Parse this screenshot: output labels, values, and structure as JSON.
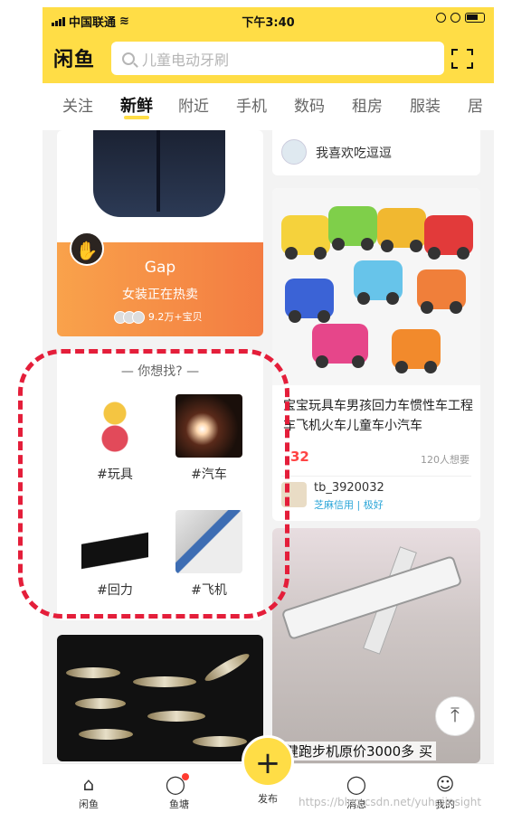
{
  "status_bar": {
    "carrier": "中国联通",
    "time": "下午3:40"
  },
  "header": {
    "logo": "闲鱼",
    "search_placeholder": "儿童电动牙刷"
  },
  "tabs": [
    {
      "label": "关注",
      "active": false
    },
    {
      "label": "新鲜",
      "active": true
    },
    {
      "label": "附近",
      "active": false
    },
    {
      "label": "手机",
      "active": false
    },
    {
      "label": "数码",
      "active": false
    },
    {
      "label": "租房",
      "active": false
    },
    {
      "label": "服装",
      "active": false
    },
    {
      "label": "居",
      "active": false
    }
  ],
  "left": {
    "gap": {
      "title": "Gap",
      "subtitle": "女装正在热卖",
      "count": "9.2万+宝贝"
    },
    "wish": {
      "title": "— 你想找? —",
      "items": [
        {
          "label": "#玩具"
        },
        {
          "label": "#汽车"
        },
        {
          "label": "#回力"
        },
        {
          "label": "#飞机"
        }
      ]
    }
  },
  "right": {
    "user_strip": {
      "name": "我喜欢吃逗逗"
    },
    "cars": {
      "title": "宝宝玩具车男孩回力车惯性车工程车飞机火车儿童车小汽车",
      "price": "32",
      "want": "120人想要",
      "seller": "tb_3920032",
      "credit": "芝麻信用 | 极好"
    },
    "treadmill": {
      "title": "健跑步机原价3000多 买"
    }
  },
  "nav": {
    "items": [
      {
        "label": "闲鱼"
      },
      {
        "label": "鱼塘"
      },
      {
        "label": "发布"
      },
      {
        "label": "消息"
      },
      {
        "label": "我的"
      }
    ]
  },
  "watermark": "https://blog.csdn.net/yuhqiinsight",
  "colors": {
    "brand_yellow": "#ffdd46",
    "price_red": "#ff4444",
    "highlight_red": "#e41e3a"
  }
}
